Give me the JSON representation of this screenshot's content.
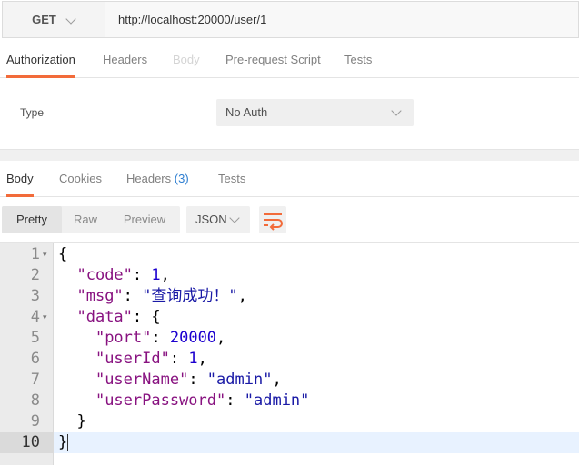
{
  "request": {
    "method": "GET",
    "url": "http://localhost:20000/user/1"
  },
  "request_tabs": {
    "authorization": "Authorization",
    "headers": "Headers",
    "body": "Body",
    "prerequest": "Pre-request Script",
    "tests": "Tests"
  },
  "auth": {
    "type_label": "Type",
    "type_value": "No Auth"
  },
  "response_tabs": {
    "body": "Body",
    "cookies": "Cookies",
    "headers": "Headers",
    "headers_count": "(3)",
    "tests": "Tests"
  },
  "format": {
    "pretty": "Pretty",
    "raw": "Raw",
    "preview": "Preview",
    "language": "JSON"
  },
  "colors": {
    "accent": "#f26b3a",
    "badge": "#2f7fd1",
    "json_key": "#881280",
    "json_string": "#1a1aa6",
    "json_number": "#1c00cf"
  },
  "response_body": {
    "line_numbers": [
      "1",
      "2",
      "3",
      "4",
      "5",
      "6",
      "7",
      "8",
      "9",
      "10"
    ],
    "code": 1,
    "msg": "查询成功！",
    "data": {
      "port": 20000,
      "userId": 1,
      "userName": "admin",
      "userPassword": "admin"
    },
    "lines": [
      "{",
      "  \"code\": 1,",
      "  \"msg\": \"查询成功！\",",
      "  \"data\": {",
      "    \"port\": 20000,",
      "    \"userId\": 1,",
      "    \"userName\": \"admin\",",
      "    \"userPassword\": \"admin\"",
      "  }",
      "}"
    ]
  }
}
